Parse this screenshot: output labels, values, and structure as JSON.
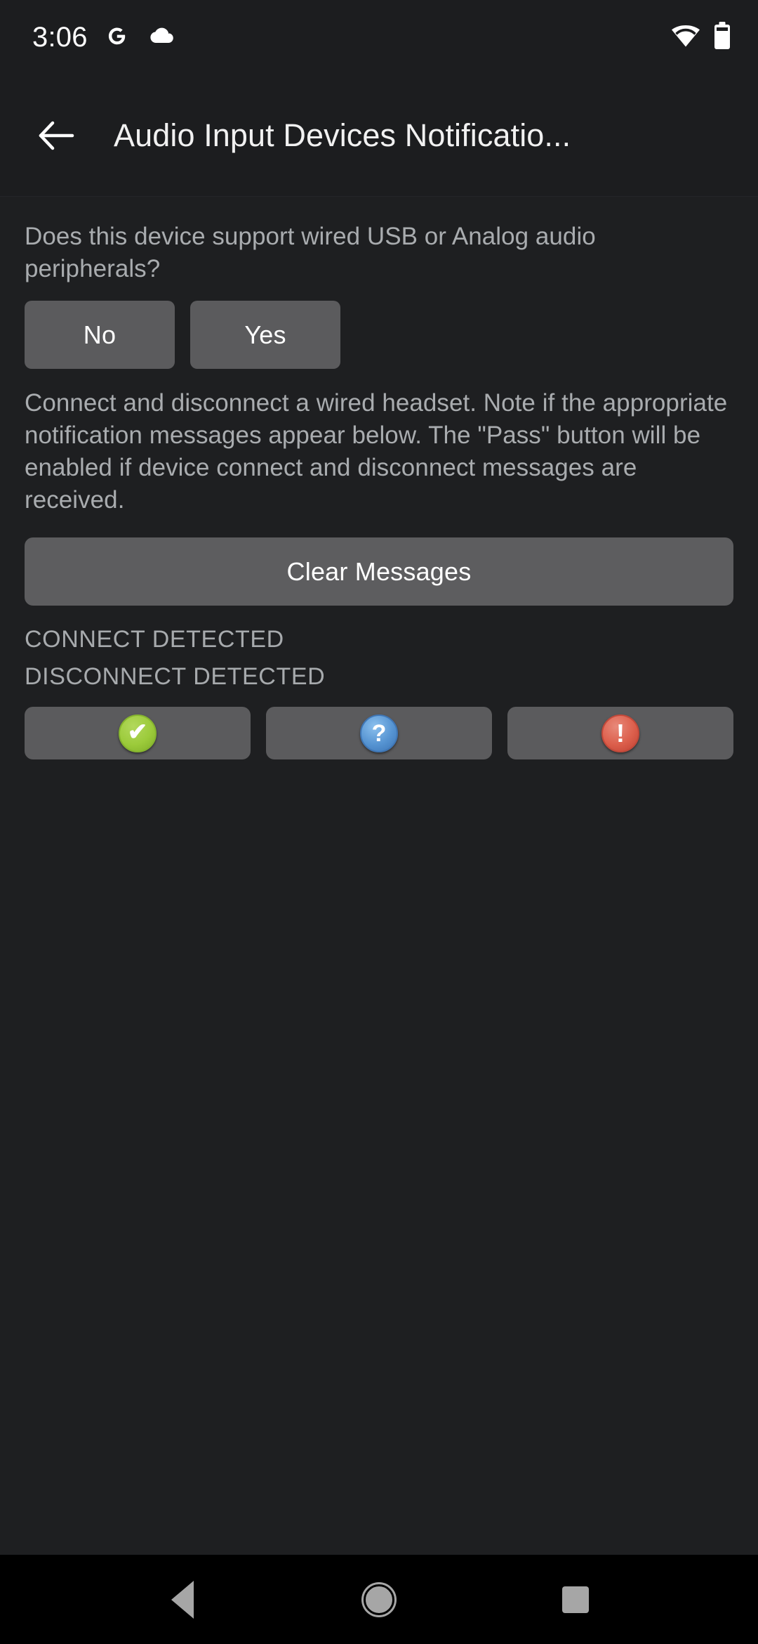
{
  "status_bar": {
    "clock": "3:06",
    "icons": [
      "google-g-icon",
      "cloud-icon",
      "wifi-icon",
      "battery-icon"
    ]
  },
  "app_bar": {
    "back_icon": "back-arrow-icon",
    "title": "Audio Input Devices Notificatio..."
  },
  "content": {
    "question": "Does this device support wired USB or Analog audio peripherals?",
    "answers": [
      {
        "label": "No",
        "name": "no-button"
      },
      {
        "label": "Yes",
        "name": "yes-button"
      }
    ],
    "instructions": "Connect and disconnect a wired headset. Note if the appropriate notification messages appear below. The \"Pass\" button will be enabled if device connect and disconnect messages are received.",
    "clear_button_label": "Clear Messages",
    "messages": [
      "CONNECT DETECTED",
      "DISCONNECT DETECTED"
    ],
    "verdict_buttons": [
      {
        "name": "pass-button",
        "icon": "check-circle-icon",
        "glyph": "✔",
        "color": "#9ccb3b"
      },
      {
        "name": "info-button",
        "icon": "question-circle-icon",
        "glyph": "?",
        "color": "#5694d2"
      },
      {
        "name": "fail-button",
        "icon": "exclamation-circle-icon",
        "glyph": "!",
        "color": "#dc5f4c"
      }
    ]
  },
  "nav_bar": {
    "back_label": "back-nav-icon",
    "home_label": "home-nav-icon",
    "recents_label": "recents-nav-icon"
  },
  "theme": {
    "background": "#1e1f21",
    "surface": "#1c1d1f",
    "button": "#5b5b5d",
    "text_primary": "#ffffff",
    "text_secondary": "#a9acaf",
    "nav_background": "#000000"
  }
}
